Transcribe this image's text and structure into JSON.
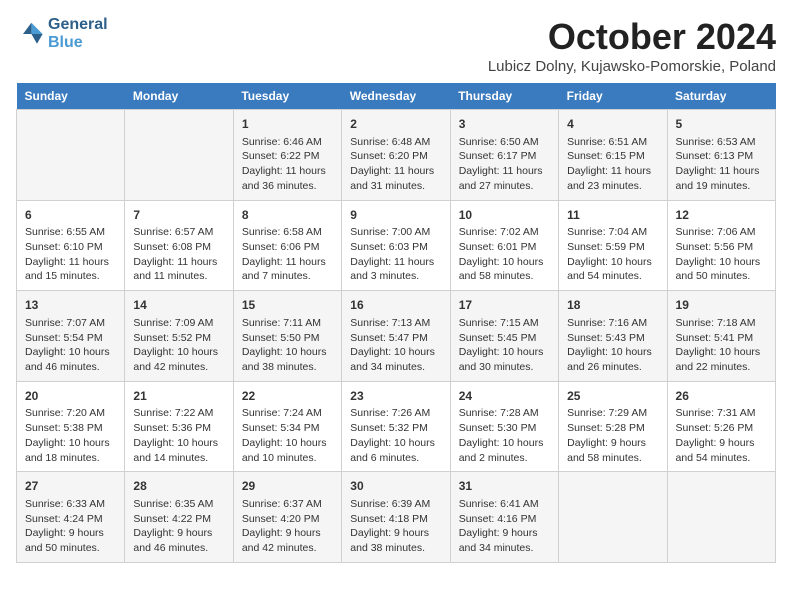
{
  "header": {
    "logo_line1": "General",
    "logo_line2": "Blue",
    "month": "October 2024",
    "location": "Lubicz Dolny, Kujawsko-Pomorskie, Poland"
  },
  "days_of_week": [
    "Sunday",
    "Monday",
    "Tuesday",
    "Wednesday",
    "Thursday",
    "Friday",
    "Saturday"
  ],
  "weeks": [
    [
      {
        "day": "",
        "info": ""
      },
      {
        "day": "",
        "info": ""
      },
      {
        "day": "1",
        "info": "Sunrise: 6:46 AM\nSunset: 6:22 PM\nDaylight: 11 hours and 36 minutes."
      },
      {
        "day": "2",
        "info": "Sunrise: 6:48 AM\nSunset: 6:20 PM\nDaylight: 11 hours and 31 minutes."
      },
      {
        "day": "3",
        "info": "Sunrise: 6:50 AM\nSunset: 6:17 PM\nDaylight: 11 hours and 27 minutes."
      },
      {
        "day": "4",
        "info": "Sunrise: 6:51 AM\nSunset: 6:15 PM\nDaylight: 11 hours and 23 minutes."
      },
      {
        "day": "5",
        "info": "Sunrise: 6:53 AM\nSunset: 6:13 PM\nDaylight: 11 hours and 19 minutes."
      }
    ],
    [
      {
        "day": "6",
        "info": "Sunrise: 6:55 AM\nSunset: 6:10 PM\nDaylight: 11 hours and 15 minutes."
      },
      {
        "day": "7",
        "info": "Sunrise: 6:57 AM\nSunset: 6:08 PM\nDaylight: 11 hours and 11 minutes."
      },
      {
        "day": "8",
        "info": "Sunrise: 6:58 AM\nSunset: 6:06 PM\nDaylight: 11 hours and 7 minutes."
      },
      {
        "day": "9",
        "info": "Sunrise: 7:00 AM\nSunset: 6:03 PM\nDaylight: 11 hours and 3 minutes."
      },
      {
        "day": "10",
        "info": "Sunrise: 7:02 AM\nSunset: 6:01 PM\nDaylight: 10 hours and 58 minutes."
      },
      {
        "day": "11",
        "info": "Sunrise: 7:04 AM\nSunset: 5:59 PM\nDaylight: 10 hours and 54 minutes."
      },
      {
        "day": "12",
        "info": "Sunrise: 7:06 AM\nSunset: 5:56 PM\nDaylight: 10 hours and 50 minutes."
      }
    ],
    [
      {
        "day": "13",
        "info": "Sunrise: 7:07 AM\nSunset: 5:54 PM\nDaylight: 10 hours and 46 minutes."
      },
      {
        "day": "14",
        "info": "Sunrise: 7:09 AM\nSunset: 5:52 PM\nDaylight: 10 hours and 42 minutes."
      },
      {
        "day": "15",
        "info": "Sunrise: 7:11 AM\nSunset: 5:50 PM\nDaylight: 10 hours and 38 minutes."
      },
      {
        "day": "16",
        "info": "Sunrise: 7:13 AM\nSunset: 5:47 PM\nDaylight: 10 hours and 34 minutes."
      },
      {
        "day": "17",
        "info": "Sunrise: 7:15 AM\nSunset: 5:45 PM\nDaylight: 10 hours and 30 minutes."
      },
      {
        "day": "18",
        "info": "Sunrise: 7:16 AM\nSunset: 5:43 PM\nDaylight: 10 hours and 26 minutes."
      },
      {
        "day": "19",
        "info": "Sunrise: 7:18 AM\nSunset: 5:41 PM\nDaylight: 10 hours and 22 minutes."
      }
    ],
    [
      {
        "day": "20",
        "info": "Sunrise: 7:20 AM\nSunset: 5:38 PM\nDaylight: 10 hours and 18 minutes."
      },
      {
        "day": "21",
        "info": "Sunrise: 7:22 AM\nSunset: 5:36 PM\nDaylight: 10 hours and 14 minutes."
      },
      {
        "day": "22",
        "info": "Sunrise: 7:24 AM\nSunset: 5:34 PM\nDaylight: 10 hours and 10 minutes."
      },
      {
        "day": "23",
        "info": "Sunrise: 7:26 AM\nSunset: 5:32 PM\nDaylight: 10 hours and 6 minutes."
      },
      {
        "day": "24",
        "info": "Sunrise: 7:28 AM\nSunset: 5:30 PM\nDaylight: 10 hours and 2 minutes."
      },
      {
        "day": "25",
        "info": "Sunrise: 7:29 AM\nSunset: 5:28 PM\nDaylight: 9 hours and 58 minutes."
      },
      {
        "day": "26",
        "info": "Sunrise: 7:31 AM\nSunset: 5:26 PM\nDaylight: 9 hours and 54 minutes."
      }
    ],
    [
      {
        "day": "27",
        "info": "Sunrise: 6:33 AM\nSunset: 4:24 PM\nDaylight: 9 hours and 50 minutes."
      },
      {
        "day": "28",
        "info": "Sunrise: 6:35 AM\nSunset: 4:22 PM\nDaylight: 9 hours and 46 minutes."
      },
      {
        "day": "29",
        "info": "Sunrise: 6:37 AM\nSunset: 4:20 PM\nDaylight: 9 hours and 42 minutes."
      },
      {
        "day": "30",
        "info": "Sunrise: 6:39 AM\nSunset: 4:18 PM\nDaylight: 9 hours and 38 minutes."
      },
      {
        "day": "31",
        "info": "Sunrise: 6:41 AM\nSunset: 4:16 PM\nDaylight: 9 hours and 34 minutes."
      },
      {
        "day": "",
        "info": ""
      },
      {
        "day": "",
        "info": ""
      }
    ]
  ]
}
